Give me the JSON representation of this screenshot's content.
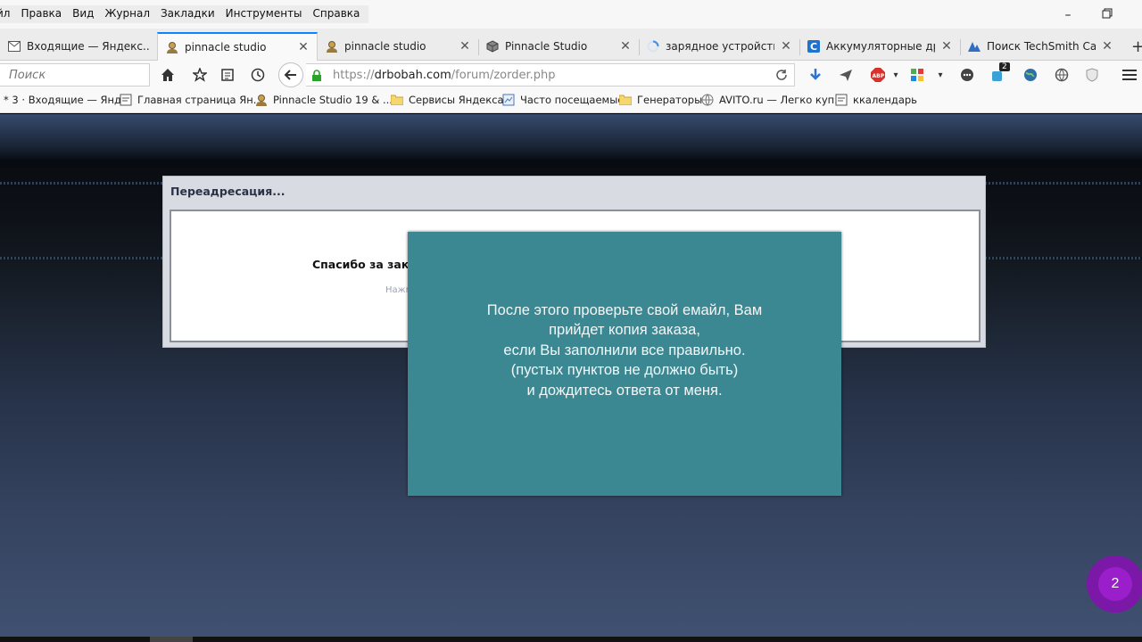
{
  "menu": [
    "йл",
    "Правка",
    "Вид",
    "Журнал",
    "Закладки",
    "Инструменты",
    "Справка"
  ],
  "tabs": [
    {
      "label": "Входящие — Яндекс....",
      "icon": "mail-icon"
    },
    {
      "label": "pinnacle studio",
      "icon": "person-icon",
      "active": true
    },
    {
      "label": "pinnacle studio",
      "icon": "person-icon"
    },
    {
      "label": "Pinnacle Studio",
      "icon": "box-icon"
    },
    {
      "label": "зарядное устройств...",
      "icon": "loading-icon"
    },
    {
      "label": "Аккумуляторные др...",
      "icon": "c-icon"
    },
    {
      "label": "Поиск TechSmith Ca...",
      "icon": "techsmith-icon"
    }
  ],
  "search": {
    "placeholder": "Поиск"
  },
  "url": {
    "prefix": "https://",
    "domain": "drbobah.com",
    "path": "/forum/zorder.php"
  },
  "toolbar": {
    "notif_count": "2"
  },
  "bookmarks": [
    {
      "label": "* 3 · Входящие — Янд...",
      "icon": "none"
    },
    {
      "label": "Главная страница Ян...",
      "icon": "page-icon"
    },
    {
      "label": "Pinnacle Studio 19 & ...",
      "icon": "person-icon"
    },
    {
      "label": "Сервисы Яндекса",
      "icon": "folder-icon"
    },
    {
      "label": "Часто посещаемые",
      "icon": "page-icon"
    },
    {
      "label": "Генераторы",
      "icon": "folder-icon"
    },
    {
      "label": "AVITO.ru — Легко куп...",
      "icon": "globe-icon"
    },
    {
      "label": "ккалендарь",
      "icon": "page-icon"
    }
  ],
  "dialog": {
    "title": "Переадресация...",
    "thanks": "Спасибо за зак",
    "hint": "Нажм"
  },
  "overlay": {
    "lines": [
      "После этого проверьте свой емайл, Вам",
      "прийдет копия заказа,",
      "если Вы заполнили все правильно.",
      "(пустых пунктов не должно быть)",
      "и дождитесь ответа от меня."
    ]
  },
  "badge": {
    "value": "2"
  }
}
